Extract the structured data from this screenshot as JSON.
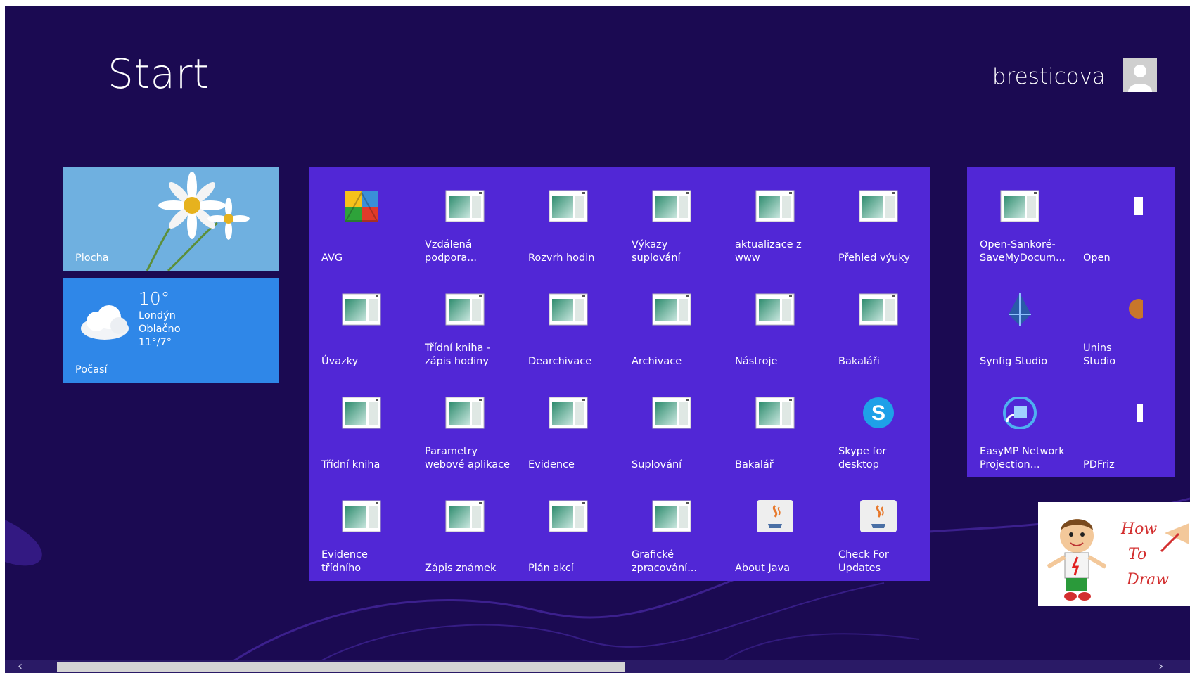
{
  "header": {
    "title": "Start",
    "username": "bresticova"
  },
  "group1": {
    "plocha": {
      "label": "Plocha"
    },
    "weather": {
      "label": "Počasí",
      "temperature": "10°",
      "city": "Londýn",
      "condition": "Oblačno",
      "range": "11°/7°"
    }
  },
  "group2": {
    "tiles": [
      {
        "label": "AVG",
        "icon": "avg-icon"
      },
      {
        "label": "Vzdálená\npodpora...",
        "icon": "app-window-icon"
      },
      {
        "label": "Rozvrh hodin",
        "icon": "app-window-icon"
      },
      {
        "label": "Výkazy suplování",
        "icon": "app-window-icon"
      },
      {
        "label": "aktualizace z\nwww",
        "icon": "app-window-icon"
      },
      {
        "label": "Přehled výuky",
        "icon": "app-window-icon"
      },
      {
        "label": "Úvazky",
        "icon": "app-window-icon"
      },
      {
        "label": "Třídní kniha -\nzápis hodiny",
        "icon": "app-window-icon"
      },
      {
        "label": "Dearchivace",
        "icon": "app-window-icon"
      },
      {
        "label": "Archivace",
        "icon": "app-window-icon"
      },
      {
        "label": "Nástroje",
        "icon": "app-window-icon"
      },
      {
        "label": "Bakaláři",
        "icon": "app-window-icon"
      },
      {
        "label": "Třídní kniha",
        "icon": "app-window-icon"
      },
      {
        "label": "Parametry\nwebové aplikace",
        "icon": "app-window-icon"
      },
      {
        "label": "Evidence",
        "icon": "app-window-icon"
      },
      {
        "label": "Suplování",
        "icon": "app-window-icon"
      },
      {
        "label": "Bakalář",
        "icon": "app-window-icon"
      },
      {
        "label": "Skype for\ndesktop",
        "icon": "skype-icon"
      },
      {
        "label": "Evidence třídního",
        "icon": "app-window-icon"
      },
      {
        "label": "Zápis známek",
        "icon": "app-window-icon"
      },
      {
        "label": "Plán akcí",
        "icon": "app-window-icon"
      },
      {
        "label": "Grafické\nzpracování...",
        "icon": "app-window-icon"
      },
      {
        "label": "About Java",
        "icon": "java-icon"
      },
      {
        "label": "Check For\nUpdates",
        "icon": "java-icon"
      }
    ]
  },
  "group3": {
    "tiles": [
      {
        "label": "Open-Sankoré-\nSaveMyDocum...",
        "icon": "app-window-icon"
      },
      {
        "label": "Open",
        "icon": "app-icon"
      },
      {
        "label": "Synfig Studio",
        "icon": "synfig-icon"
      },
      {
        "label": "Unins\nStudio",
        "icon": "uninstall-icon"
      },
      {
        "label": "EasyMP Network\nProjection...",
        "icon": "easymp-icon"
      },
      {
        "label": "PDFriz",
        "icon": "pdf-icon"
      }
    ],
    "howto": {
      "line1": "How",
      "line2": "To",
      "line3": "Draw"
    }
  },
  "colors": {
    "background": "#1b0a52",
    "tile": "#5127d6",
    "weather": "#2f87e8"
  }
}
